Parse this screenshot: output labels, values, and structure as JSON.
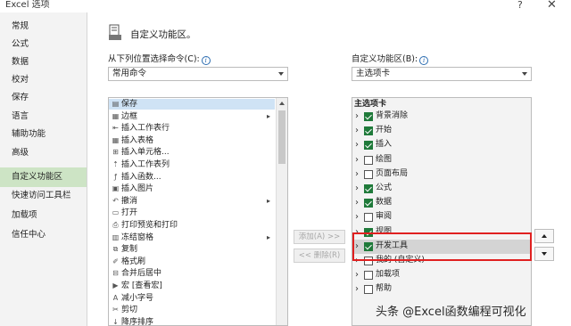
{
  "window": {
    "title": "Excel 选项",
    "help": "?",
    "close": "✕"
  },
  "nav": [
    {
      "label": "常规",
      "active": false
    },
    {
      "label": "公式",
      "active": false
    },
    {
      "label": "数据",
      "active": false
    },
    {
      "label": "校对",
      "active": false
    },
    {
      "label": "保存",
      "active": false
    },
    {
      "label": "语言",
      "active": false
    },
    {
      "label": "辅助功能",
      "active": false
    },
    {
      "label": "高级",
      "active": false
    },
    {
      "label": "自定义功能区",
      "active": true
    },
    {
      "label": "快速访问工具栏",
      "active": false
    },
    {
      "label": "加载项",
      "active": false
    },
    {
      "label": "信任中心",
      "active": false
    }
  ],
  "header": {
    "title": "自定义功能区。"
  },
  "left_panel": {
    "label": "从下列位置选择命令(C):",
    "dropdown_value": "常用命令",
    "commands": [
      {
        "icon": "save-icon",
        "glyph": "▤",
        "label": "保存",
        "submenu": false,
        "selected": true
      },
      {
        "icon": "border-icon",
        "glyph": "▦",
        "label": "边框",
        "submenu": true,
        "selected": false
      },
      {
        "icon": "insert-row-icon",
        "glyph": "⇤",
        "label": "插入工作表行",
        "submenu": false,
        "selected": false
      },
      {
        "icon": "table-icon",
        "glyph": "▦",
        "label": "插入表格",
        "submenu": false,
        "selected": false
      },
      {
        "icon": "insert-cell-icon",
        "glyph": "⊞",
        "label": "插入单元格...",
        "submenu": false,
        "selected": false
      },
      {
        "icon": "insert-column-icon",
        "glyph": "⇡",
        "label": "插入工作表列",
        "submenu": false,
        "selected": false
      },
      {
        "icon": "function-icon",
        "glyph": "ƒ",
        "label": "插入函数...",
        "submenu": false,
        "selected": false
      },
      {
        "icon": "picture-icon",
        "glyph": "▣",
        "label": "插入图片",
        "submenu": false,
        "selected": false
      },
      {
        "icon": "undo-icon",
        "glyph": "↶",
        "label": "撤消",
        "submenu": true,
        "selected": false
      },
      {
        "icon": "open-icon",
        "glyph": "▭",
        "label": "打开",
        "submenu": false,
        "selected": false
      },
      {
        "icon": "print-preview-icon",
        "glyph": "⎙",
        "label": "打印预览和打印",
        "submenu": false,
        "selected": false
      },
      {
        "icon": "freeze-panes-icon",
        "glyph": "▥",
        "label": "冻结窗格",
        "submenu": true,
        "selected": false
      },
      {
        "icon": "copy-icon",
        "glyph": "⧉",
        "label": "复制",
        "submenu": false,
        "selected": false
      },
      {
        "icon": "format-painter-icon",
        "glyph": "✐",
        "label": "格式刷",
        "submenu": false,
        "selected": false
      },
      {
        "icon": "merge-center-icon",
        "glyph": "⊟",
        "label": "合并后居中",
        "submenu": false,
        "selected": false
      },
      {
        "icon": "macro-icon",
        "glyph": "▶",
        "label": "宏 [查看宏]",
        "submenu": false,
        "selected": false
      },
      {
        "icon": "decrease-font-icon",
        "glyph": "A",
        "label": "减小字号",
        "submenu": false,
        "selected": false
      },
      {
        "icon": "cut-icon",
        "glyph": "✂",
        "label": "剪切",
        "submenu": false,
        "selected": false
      },
      {
        "icon": "sort-desc-icon",
        "glyph": "↓",
        "label": "降序排序",
        "submenu": false,
        "selected": false
      }
    ]
  },
  "right_panel": {
    "label": "自定义功能区(B):",
    "dropdown_value": "主选项卡",
    "list_header": "主选项卡",
    "tabs": [
      {
        "label": "背景消除",
        "checked": true,
        "selected": false
      },
      {
        "label": "开始",
        "checked": true,
        "selected": false
      },
      {
        "label": "插入",
        "checked": true,
        "selected": false
      },
      {
        "label": "绘图",
        "checked": false,
        "selected": false
      },
      {
        "label": "页面布局",
        "checked": false,
        "selected": false
      },
      {
        "label": "公式",
        "checked": true,
        "selected": false
      },
      {
        "label": "数据",
        "checked": true,
        "selected": false
      },
      {
        "label": "审阅",
        "checked": false,
        "selected": false
      },
      {
        "label": "视图",
        "checked": true,
        "selected": false
      },
      {
        "label": "开发工具",
        "checked": true,
        "selected": true
      },
      {
        "label": "我的 (自定义)",
        "checked": false,
        "selected": false
      },
      {
        "label": "加载项",
        "checked": false,
        "selected": false
      },
      {
        "label": "帮助",
        "checked": false,
        "selected": false
      }
    ]
  },
  "buttons": {
    "add": "添加(A) >>",
    "remove": "<< 删除(R)"
  },
  "watermark": "头条 @Excel函数编程可视化",
  "colors": {
    "nav_active": "#cde4c5",
    "checkbox_on": "#1f7a3a",
    "highlight_border": "#e02020"
  }
}
